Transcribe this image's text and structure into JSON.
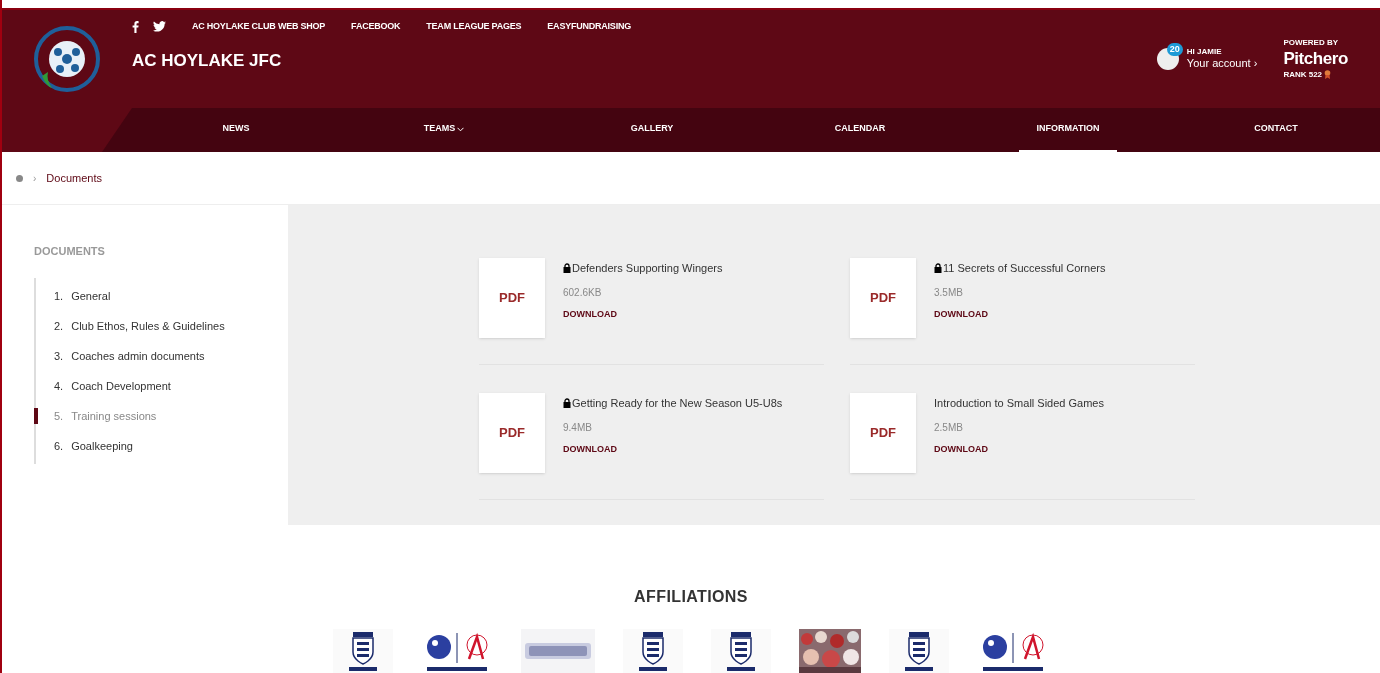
{
  "header": {
    "social_icons": [
      {
        "kind": "facebook"
      },
      {
        "kind": "twitter"
      }
    ],
    "top_links": [
      "AC HOYLAKE CLUB WEB SHOP",
      "FACEBOOK",
      "TEAM LEAGUE PAGES",
      "EASYFUNDRAISING"
    ],
    "club_name": "AC HOYLAKE JFC",
    "account": {
      "badge": "20",
      "greeting": "HI JAMIE",
      "link": "Your account ›"
    },
    "powered": {
      "label": "POWERED BY",
      "brand": "Pitchero",
      "rank": "RANK 522"
    }
  },
  "nav": [
    {
      "label": "NEWS",
      "selected": false,
      "dropdown": false
    },
    {
      "label": "TEAMS",
      "selected": false,
      "dropdown": true
    },
    {
      "label": "GALLERY",
      "selected": false,
      "dropdown": false
    },
    {
      "label": "CALENDAR",
      "selected": false,
      "dropdown": false
    },
    {
      "label": "INFORMATION",
      "selected": true,
      "dropdown": false
    },
    {
      "label": "CONTACT",
      "selected": false,
      "dropdown": false
    }
  ],
  "breadcrumb": {
    "separator": "›",
    "current": "Documents"
  },
  "sidebar": {
    "title": "DOCUMENTS",
    "items": [
      {
        "number": "1.",
        "label": "General",
        "selected": false
      },
      {
        "number": "2.",
        "label": "Club Ethos, Rules & Guidelines",
        "selected": false
      },
      {
        "number": "3.",
        "label": "Coaches admin documents",
        "selected": false
      },
      {
        "number": "4.",
        "label": "Coach Development",
        "selected": false
      },
      {
        "number": "5.",
        "label": "Training sessions",
        "selected": true
      },
      {
        "number": "6.",
        "label": "Goalkeeping",
        "selected": false
      }
    ]
  },
  "documents": [
    {
      "type": "PDF",
      "title": "Defenders Supporting Wingers",
      "locked": true,
      "size": "602.6KB",
      "action": "DOWNLOAD"
    },
    {
      "type": "PDF",
      "title": "11 Secrets of Successful Corners",
      "locked": true,
      "size": "3.5MB",
      "action": "DOWNLOAD"
    },
    {
      "type": "PDF",
      "title": "Getting Ready for the New Season U5-U8s",
      "locked": true,
      "size": "9.4MB",
      "action": "DOWNLOAD"
    },
    {
      "type": "PDF",
      "title": "Introduction to Small Sided Games",
      "locked": false,
      "size": "2.5MB",
      "action": "DOWNLOAD"
    }
  ],
  "affiliations": {
    "title": "AFFILIATIONS",
    "logos": [
      {
        "kind": "crest"
      },
      {
        "kind": "emblem"
      },
      {
        "kind": "wordmark"
      },
      {
        "kind": "crest"
      },
      {
        "kind": "crest"
      },
      {
        "kind": "picture"
      },
      {
        "kind": "crest"
      },
      {
        "kind": "emblem"
      }
    ]
  }
}
